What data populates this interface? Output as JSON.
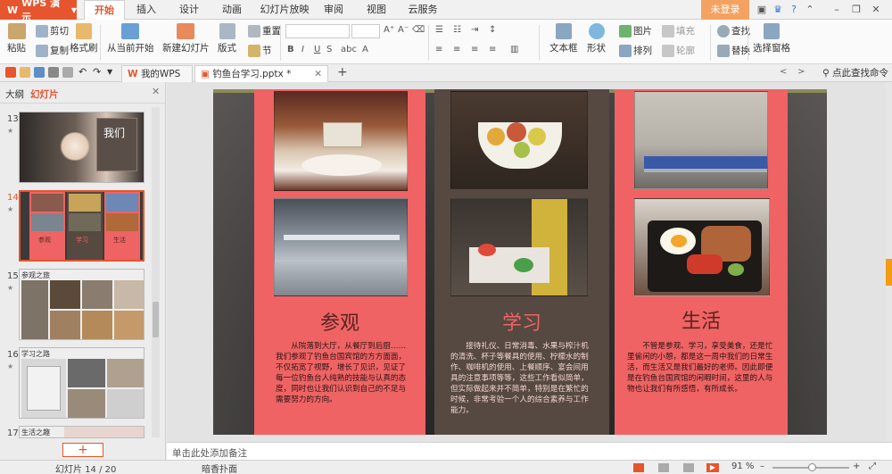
{
  "app": {
    "name": "WPS 演示"
  },
  "menu": {
    "tabs": [
      "开始",
      "插入",
      "设计",
      "动画",
      "幻灯片放映",
      "审阅",
      "视图",
      "云服务"
    ],
    "login": "未登录"
  },
  "ribbon": {
    "paste": "粘贴",
    "cut": "剪切",
    "copy": "复制",
    "format_painter": "格式刷",
    "from_current": "从当前开始",
    "new_slide": "新建幻灯片",
    "layout": "版式",
    "reset": "重置",
    "section": "节",
    "textbox": "文本框",
    "shape": "形状",
    "picture": "图片",
    "fill": "填充",
    "arrange": "排列",
    "outline": "轮廓",
    "find": "查找",
    "replace": "替换",
    "selection_pane": "选择窗格"
  },
  "tabbar": {
    "tabs": [
      "我的WPS",
      "钓鱼台学习.pptx *"
    ],
    "find_command": "点此查找命令"
  },
  "leftpanel": {
    "tabs": [
      "大纲",
      "幻灯片"
    ],
    "thumbs": [
      {
        "num": "13",
        "title": "我们"
      },
      {
        "num": "14",
        "title": ""
      },
      {
        "num": "15",
        "title": "参观之旅"
      },
      {
        "num": "16",
        "title": "学习之路"
      },
      {
        "num": "17",
        "title": "生活之趣"
      }
    ],
    "thumb14_labels": [
      "参观",
      "学习",
      "生活"
    ]
  },
  "slide": {
    "columns": [
      {
        "heading": "参观",
        "text": "从院落到大厅，从餐厅到后厨……我们参观了钓鱼台国宾馆的方方面面，不仅拓宽了视野，增长了见识，见证了每一位钓鱼台人纯熟的技能与认真的态度，同时也让我们认识到自己的不足与需要努力的方向。"
      },
      {
        "heading": "学习",
        "text": "接待礼仪、日常消毒、水果与榨汁机的清洗、杯子等餐具的使用、柠檬水的制作、咖啡机的使用、上餐顺序、宴会间用具的注意事项等等，这些工作看似简单，但实际做起来并不简单，特别是在繁忙的时候，非常考验一个人的综合素养与工作能力。"
      },
      {
        "heading": "生活",
        "text": "不管是参观、学习，享受美食，还是忙里偷闲的小憩，都是这一周中我们的日常生活，而生活又是我们最好的老师。因此即便是在钓鱼台国宾馆的闲暇时间，这里的人与物也让我们有所感悟，有所成长。"
      }
    ]
  },
  "notes": {
    "placeholder": "单击此处添加备注"
  },
  "status": {
    "slide_count": "幻灯片 14 / 20",
    "theme": "暗香扑面",
    "zoom": "91 %"
  },
  "colors": {
    "accent": "#e6552d",
    "salmon": "#ef6364",
    "brown": "#554941"
  }
}
